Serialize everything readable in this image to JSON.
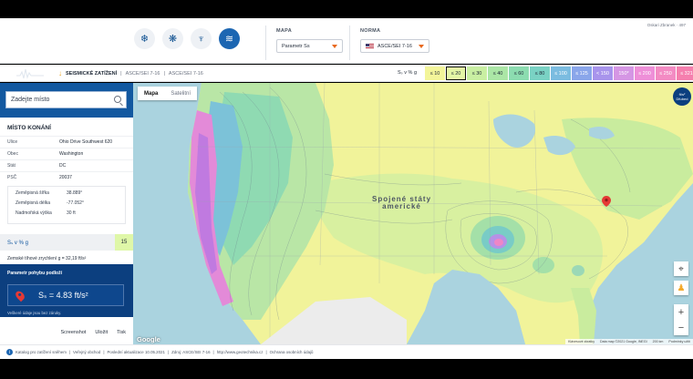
{
  "header": {
    "account": "Oskari Zbranek · 497",
    "load_types": [
      {
        "icon": "snowflake-icon",
        "glyph": "❄",
        "active": false
      },
      {
        "icon": "wind-icon",
        "glyph": "❋",
        "active": false
      },
      {
        "icon": "tornado-icon",
        "glyph": "♆",
        "active": false
      },
      {
        "icon": "seismic-icon",
        "glyph": "≋",
        "active": true
      }
    ],
    "map_label": "MAPA",
    "map_value": "Parametr Ss",
    "norm_label": "NORMA",
    "norm_value": "ASCE/SEI 7-16"
  },
  "legend": {
    "breadcrumb_current": "SEISMICKÉ ZATÍŽENÍ",
    "breadcrumb_1": "ASCE/SEI 7-16",
    "breadcrumb_2": "ASCE/SEI 7-16",
    "title": "Sₛ v % g",
    "items": [
      {
        "label": "≤ 10",
        "color": "#f3f59a",
        "text": "#1f2937"
      },
      {
        "label": "≤ 20",
        "color": "#e4f6a6",
        "text": "#1f2937",
        "selected": true
      },
      {
        "label": "≤ 30",
        "color": "#c9efa2",
        "text": "#1f2937"
      },
      {
        "label": "≤ 40",
        "color": "#abe6a6",
        "text": "#1f2937"
      },
      {
        "label": "≤ 60",
        "color": "#8cdcb0",
        "text": "#1f2937"
      },
      {
        "label": "≤ 80",
        "color": "#7ad2c4",
        "text": "#1f2937"
      },
      {
        "label": "≤ 100",
        "color": "#7bbce0",
        "text": "#ffffff"
      },
      {
        "label": "≤ 125",
        "color": "#8aa6ea",
        "text": "#ffffff"
      },
      {
        "label": "< 150",
        "color": "#a894ec",
        "text": "#ffffff"
      },
      {
        "label": "150*",
        "color": "#d596e4",
        "text": "#ffffff"
      },
      {
        "label": "≤ 200",
        "color": "#ee8fd8",
        "text": "#ffffff"
      },
      {
        "label": "≤ 250",
        "color": "#f38bc3",
        "text": "#ffffff"
      },
      {
        "label": "≤ 321",
        "color": "#f57fae",
        "text": "#ffffff"
      }
    ]
  },
  "sidebar": {
    "search_placeholder": "Zadejte místo",
    "section_title": "MÍSTO KONÁNÍ",
    "fields": [
      {
        "key": "Ulice",
        "value": "Ohio Drive Southwest 620"
      },
      {
        "key": "Obec",
        "value": "Washington"
      },
      {
        "key": "Stát",
        "value": "DC"
      },
      {
        "key": "PSČ",
        "value": "20037"
      }
    ],
    "coords": [
      {
        "key": "Zeměpisná šířka",
        "value": "38.889°"
      },
      {
        "key": "Zeměpisná délka",
        "value": "-77.052°"
      },
      {
        "key": "Nadmořská výška",
        "value": "30 ft"
      }
    ],
    "ss_label": "Sₛ v % g",
    "ss_value": "15",
    "gravity": "Zemské tíhové zrychlení g = 32,19 ft/s²",
    "param_title": "Parametr pohybu podloží",
    "param_value": "Sₛ = 4.83 ft/s²",
    "param_note": "Veškeré údaje jsou bez záruky.",
    "links": {
      "screenshot": "Screenshot",
      "save": "Uložit",
      "print": "Tisk"
    }
  },
  "map": {
    "tab_map": "Mapa",
    "tab_satellite": "Satelitní",
    "country_line1": "Spojené státy",
    "country_line2": "americké",
    "unit_top": "ft/s²",
    "unit_bottom": "Dfubed",
    "google": "Google",
    "attribution": [
      "Klávesové zkratky",
      "Data map ©2021 Google, INEGI",
      "200 km",
      "Podmínky užití"
    ]
  },
  "footer": {
    "items": [
      "Katalog pro zatížení sněhem",
      "Veřejný obchod",
      "Poslední aktualizace 10.05.2021",
      "Zdroj: ASCE/SEI 7-16",
      "http://www.geotechnika.cz",
      "Ochrana osobních údajů"
    ]
  }
}
